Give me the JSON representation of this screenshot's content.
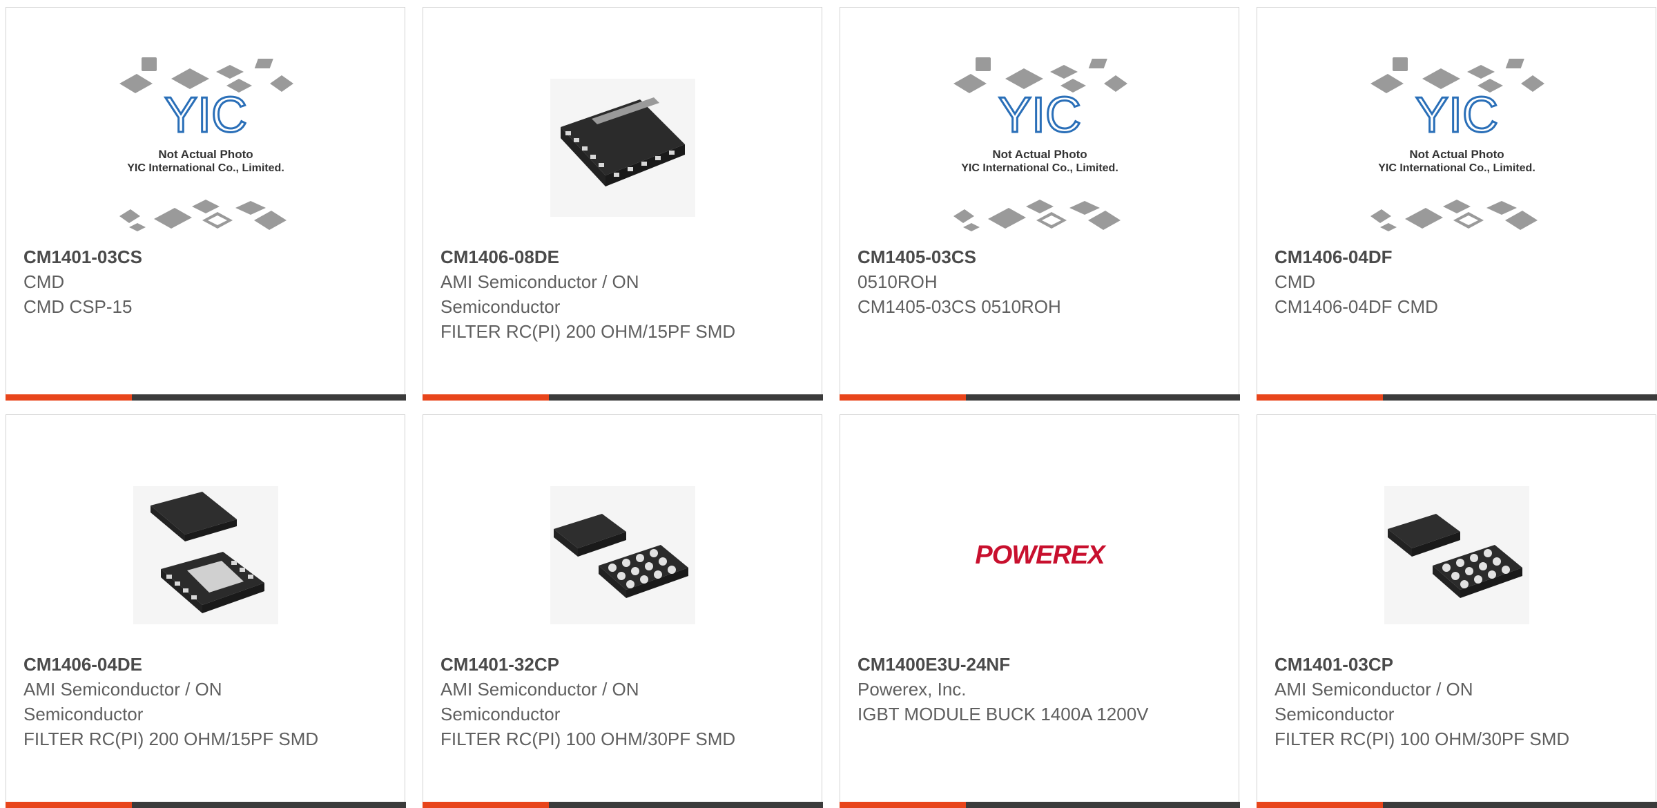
{
  "colors": {
    "accent_bar": "#e8451b",
    "dark_bar": "#3b3b3b",
    "border": "#d2d2d2"
  },
  "products": [
    {
      "part_number": "CM1401-03CS",
      "manufacturer": "CMD",
      "description": "CMD CSP-15",
      "image": "placeholder-not-actual-photo",
      "placeholder_title": "Not Actual Photo",
      "placeholder_company": "YIC International Co., Limited.",
      "logo_text": "YIC"
    },
    {
      "part_number": "CM1406-08DE",
      "manufacturer": "AMI Semiconductor / ON Semiconductor",
      "description": "FILTER RC(PI) 200 OHM/15PF SMD",
      "image": "chip-dfn-16-pin"
    },
    {
      "part_number": "CM1405-03CS",
      "manufacturer": "0510ROH",
      "description": "CM1405-03CS 0510ROH",
      "image": "placeholder-not-actual-photo",
      "placeholder_title": "Not Actual Photo",
      "placeholder_company": "YIC International Co., Limited.",
      "logo_text": "YIC"
    },
    {
      "part_number": "CM1406-04DF",
      "manufacturer": "CMD",
      "description": "CM1406-04DF CMD",
      "image": "placeholder-not-actual-photo",
      "placeholder_title": "Not Actual Photo",
      "placeholder_company": "YIC International Co., Limited.",
      "logo_text": "YIC"
    },
    {
      "part_number": "CM1406-04DE",
      "manufacturer": "AMI Semiconductor / ON Semiconductor",
      "description": "FILTER RC(PI) 200 OHM/15PF SMD",
      "image": "chip-dfn-pair"
    },
    {
      "part_number": "CM1401-32CP",
      "manufacturer": "AMI Semiconductor / ON Semiconductor",
      "description": "FILTER RC(PI) 100 OHM/30PF SMD",
      "image": "chip-bga-pair"
    },
    {
      "part_number": "CM1400E3U-24NF",
      "manufacturer": "Powerex, Inc.",
      "description": "IGBT MODULE BUCK 1400A 1200V",
      "image": "powerex-logo",
      "logo_text": "POWEREX"
    },
    {
      "part_number": "CM1401-03CP",
      "manufacturer": "AMI Semiconductor / ON Semiconductor",
      "description": "FILTER RC(PI) 100 OHM/30PF SMD",
      "image": "chip-bga-pair"
    }
  ]
}
